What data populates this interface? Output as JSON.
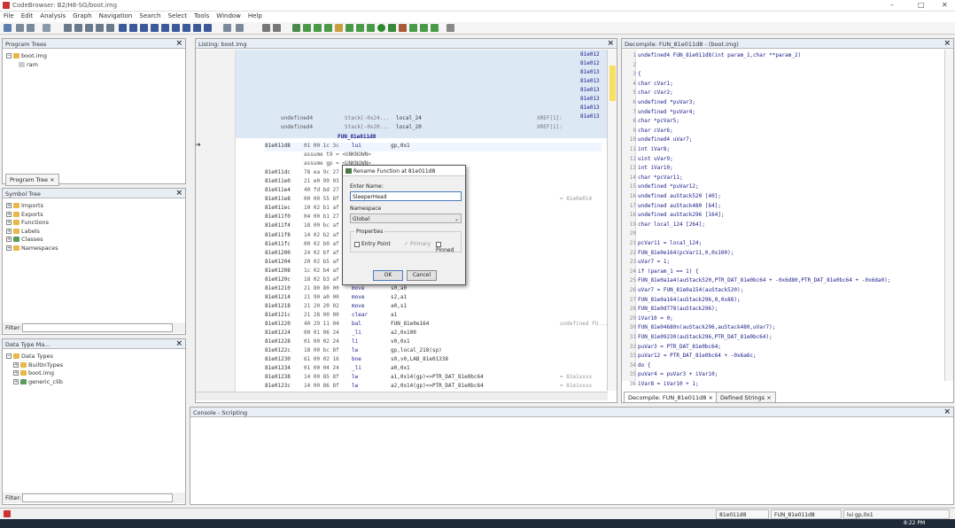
{
  "window": {
    "title": "CodeBrowser: B2/H8-SG/boot.img",
    "minimize": "–",
    "maximize": "□",
    "close": "✕"
  },
  "menu": [
    "File",
    "Edit",
    "Analysis",
    "Graph",
    "Navigation",
    "Search",
    "Select",
    "Tools",
    "Window",
    "Help"
  ],
  "program_trees": {
    "title": "Program Trees",
    "items": [
      "boot.img",
      "ram"
    ],
    "tab": "Program Tree"
  },
  "symbol_tree": {
    "title": "Symbol Tree",
    "items": [
      "Imports",
      "Exports",
      "Functions",
      "Labels",
      "Classes",
      "Namespaces"
    ],
    "filter_label": "Filter:"
  },
  "data_type_manager": {
    "title": "Data Type Ma...",
    "items": [
      "Data Types",
      "BuiltInTypes",
      "boot.img",
      "generic_clib"
    ],
    "filter_label": "Filter:"
  },
  "listing": {
    "title": "Listing:  boot.img",
    "xref_labels": [
      "81e012",
      "81e012",
      "81e013",
      "81e013",
      "81e013",
      "81e013",
      "81e013",
      "81e013"
    ],
    "stack_rows": [
      {
        "type": "undefined4",
        "stack": "Stack[-0x24...",
        "name": "local_24",
        "xref": "XREF[1]:",
        "ref": "81e01..."
      },
      {
        "type": "undefined4",
        "stack": "Stack[-0x20...",
        "name": "local_20",
        "xref": "XREF[1]:",
        "ref": "81e01..."
      }
    ],
    "function_label": "FUN_81e011d8",
    "rows": [
      {
        "addr": "81e011d8",
        "bytes": "01 00 1c 3c",
        "mn": "lui",
        "op": "gp,0x1",
        "cm": ""
      },
      {
        "addr": "",
        "bytes": "assume t9 = <UNKNOWN>",
        "mn": "",
        "op": "",
        "cm": ""
      },
      {
        "addr": "",
        "bytes": "assume gp = <UNKNOWN>",
        "mn": "",
        "op": "",
        "cm": ""
      },
      {
        "addr": "81e011dc",
        "bytes": "78 ea 9c 27",
        "mn": "",
        "op": "",
        "cm": ""
      },
      {
        "addr": "81e011e0",
        "bytes": "21 e0 99 03",
        "mn": "",
        "op": "",
        "cm": ""
      },
      {
        "addr": "81e011e4",
        "bytes": "40 fd bd 27",
        "mn": "",
        "op": "",
        "cm": ""
      },
      {
        "addr": "81e011e8",
        "bytes": "00 00 55 8f",
        "mn": "",
        "op": "...0e14",
        "cm": "= 81e0e014"
      },
      {
        "addr": "81e011ec",
        "bytes": "10 02 b1 af",
        "mn": "",
        "op": "",
        "cm": ""
      },
      {
        "addr": "81e011f0",
        "bytes": "04 00 b1 27",
        "mn": "",
        "op": "",
        "cm": ""
      },
      {
        "addr": "81e011f4",
        "bytes": "18 00 bc af",
        "mn": "",
        "op": "",
        "cm": ""
      },
      {
        "addr": "81e011f8",
        "bytes": "14 02 b2 af",
        "mn": "",
        "op": "",
        "cm": ""
      },
      {
        "addr": "81e011fc",
        "bytes": "00 02 b0 af",
        "mn": "",
        "op": "",
        "cm": ""
      },
      {
        "addr": "81e01200",
        "bytes": "24 02 bf af",
        "mn": "",
        "op": "",
        "cm": ""
      },
      {
        "addr": "81e01204",
        "bytes": "20 02 b5 af",
        "mn": "",
        "op": "",
        "cm": ""
      },
      {
        "addr": "81e01208",
        "bytes": "1c 02 b4 af",
        "mn": "",
        "op": "",
        "cm": ""
      },
      {
        "addr": "81e0120c",
        "bytes": "18 02 b3 af",
        "mn": "",
        "op": "",
        "cm": ""
      },
      {
        "addr": "81e01210",
        "bytes": "21 80 80 00",
        "mn": "move",
        "op": "s0,a0",
        "cm": ""
      },
      {
        "addr": "81e01214",
        "bytes": "21 90 a0 00",
        "mn": "move",
        "op": "s2,a1",
        "cm": ""
      },
      {
        "addr": "81e01218",
        "bytes": "21 20 20 02",
        "mn": "move",
        "op": "a0,s1",
        "cm": ""
      },
      {
        "addr": "81e0121c",
        "bytes": "21 28 00 00",
        "mn": "clear",
        "op": "a1",
        "cm": ""
      },
      {
        "addr": "81e01220",
        "bytes": "40 29 11 04",
        "mn": "bal",
        "op": "FUN_81e0e164",
        "cm": "undefined FU..."
      },
      {
        "addr": "81e01224",
        "bop": "",
        "bytes": "00 01 06 24",
        "mn": "_li",
        "op": "a2,0x100",
        "cm": ""
      },
      {
        "addr": "81e01228",
        "bytes": "01 00 02 24",
        "mn": "li",
        "op": "v0,0x1",
        "cm": ""
      },
      {
        "addr": "81e0122c",
        "bytes": "18 00 bc 8f",
        "mn": "lw",
        "op": "gp,local_218(sp)",
        "cm": ""
      },
      {
        "addr": "81e01230",
        "bytes": "61 00 02 16",
        "mn": "bne",
        "op": "s0,v0,LAB_81e01338",
        "cm": ""
      },
      {
        "addr": "81e01234",
        "bytes": "01 00 04 24",
        "mn": "_li",
        "op": "a0,0x1",
        "cm": ""
      },
      {
        "addr": "81e01238",
        "bytes": "14 00 85 8f",
        "mn": "lw",
        "op": "a1,0x14(gp)=>PTR_DAT_81e0bc64",
        "cm": "= 81e1xxxx"
      },
      {
        "addr": "81e0123c",
        "bytes": "14 00 86 8f",
        "mn": "lw",
        "op": "a2,0x14(gp)=>PTR_DAT_81e0bc64",
        "cm": "= 81e1xxxx"
      }
    ]
  },
  "rename_dialog": {
    "title": "Rename Function at 81e011d8",
    "enter_name_label": "Enter Name:",
    "name_value": "SleeperHead",
    "namespace_label": "Namespace",
    "namespace_value": "Global",
    "properties_label": "Properties",
    "entry_point": "Entry Point",
    "primary": "Primary",
    "pinned": "Pinned",
    "ok": "OK",
    "cancel": "Cancel"
  },
  "decompile": {
    "title": "Decompile: FUN_81e011d8 - (boot.img)",
    "lines": [
      "undefined4 FUN_81e011d8(int param_1,char **param_2)",
      "",
      "{",
      "  char cVar1;",
      "  char cVar2;",
      "  undefined *puVar3;",
      "  undefined *puVar4;",
      "  char *pcVar5;",
      "  char cVar6;",
      "  undefined4 uVar7;",
      "  int iVar8;",
      "  uint uVar9;",
      "  int iVar10;",
      "  char *pcVar11;",
      "  undefined *puVar12;",
      "  undefined auStack520 [40];",
      "  undefined auStack480 [64];",
      "  undefined auStack296 [164];",
      "  char local_124 [264];",
      "",
      "  pcVar11 = local_124;",
      "  FUN_81e0e164(pcVar11,0,0x100);",
      "  uVar7 = 1;",
      "  if (param_1 == 1) {",
      "    FUN_81e0a1a4(auStack520,PTR_DAT_81e0bc64 + -0x6d80,PTR_DAT_81e0bc64 + -0x6da0);",
      "    uVar7 = FUN_81e0a154(auStack520);",
      "    FUN_81e0a164(auStack296,0,0x88);",
      "    FUN_81e0d778(auStack296);",
      "    iVar10 = 0;",
      "    FUN_81e04680n(auStack296,auStack480,uVar7);",
      "    FUN_81e09230(auStack296,PTR_DAT_81e0bc64);",
      "    puVar3 = PTR_DAT_81e0bc64;",
      "    puVar12 = PTR_DAT_81e0bc64 + -0x6a6c;",
      "    do {",
      "      puVar4 = puVar3 + iVar10;",
      "      iVar8 = iVar10 + 1;"
    ],
    "tab_decompile": "Decompile: FUN_81e011d8",
    "tab_defined": "Defined Strings"
  },
  "console": {
    "tab_console": "Console - Scripting"
  },
  "status": {
    "addr": "81e011d8",
    "func": "FUN_81e011d8",
    "instr": "lui gp,0x1"
  },
  "taskbar": {
    "time": "8:22 PM"
  },
  "colors": {
    "selection": "#dde8f5",
    "highlight": "#f7f48a",
    "accent": "#1a1a8a"
  }
}
